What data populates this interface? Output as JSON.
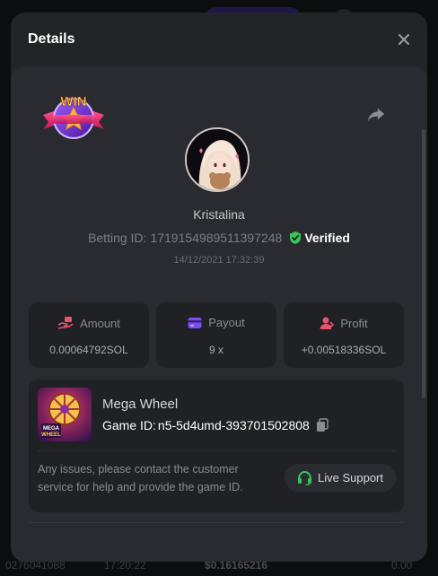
{
  "modal": {
    "title": "Details",
    "user": {
      "name": "Kristalina",
      "betting_id_label": "Betting ID:",
      "betting_id": "1719154989511397248",
      "verified_label": "Verified",
      "timestamp": "14/12/2021 17:32:39"
    },
    "stats": [
      {
        "label": "Amount",
        "value": "0.00064792SOL",
        "icon": "money-hand-icon",
        "color": "#e8536d"
      },
      {
        "label": "Payout",
        "value": "9 x",
        "icon": "card-icon",
        "color": "#7b4df0"
      },
      {
        "label": "Profit",
        "value": "+0.00518336SOL",
        "icon": "profit-user-icon",
        "color": "#e8536d"
      }
    ],
    "game": {
      "name": "Mega Wheel",
      "id_label": "Game ID:",
      "id_value": "n5-5d4umd-393701502808",
      "thumb_text_1": "MEGA",
      "thumb_text_2": "WHEEL"
    },
    "help_text": "Any issues, please contact the customer service for help and provide the game ID.",
    "live_support_label": "Live Support",
    "win_badge_text": "WIN"
  },
  "background": {
    "bottom_row": [
      "0276041088",
      "17:20:22",
      "$0.16165216",
      "0.00"
    ]
  },
  "colors": {
    "accent_green": "#35c759",
    "modal_bg": "#232428",
    "card_bg": "#202125"
  }
}
